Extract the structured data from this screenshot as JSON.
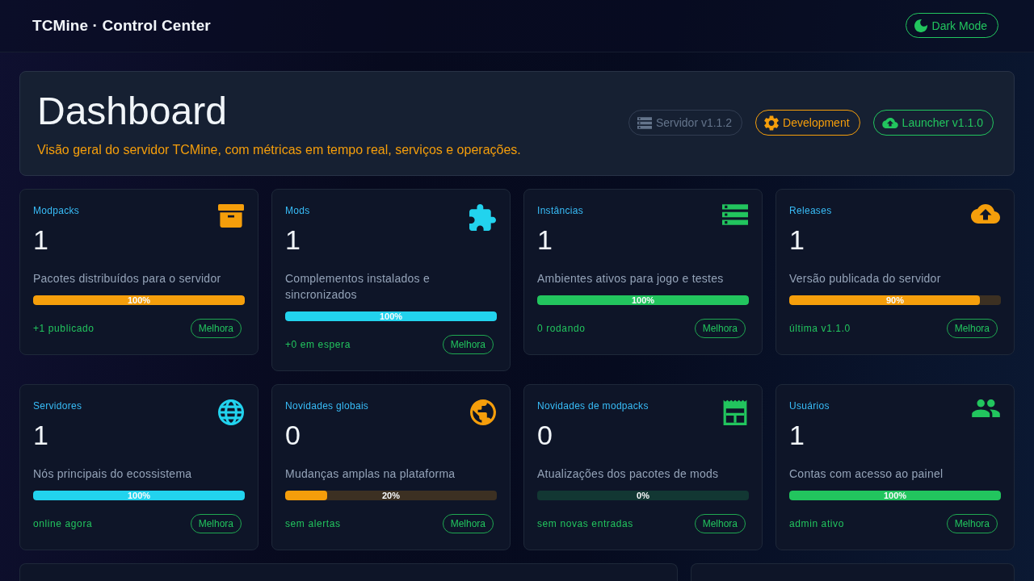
{
  "header": {
    "title": "TCMine · Control Center",
    "theme_toggle": {
      "label": "Dark Mode"
    }
  },
  "hero": {
    "title": "Dashboard",
    "subtitle": "Visão geral do servidor TCMine, com métricas em tempo real, serviços e operações.",
    "badges": [
      {
        "label": "Servidor v1.1.2",
        "disabled": true,
        "color": "#64748b"
      },
      {
        "label": "Development",
        "disabled": false,
        "color": "#f59e0b"
      },
      {
        "label": "Launcher v1.1.0",
        "disabled": false,
        "color": "#22c55e"
      }
    ]
  },
  "cards": [
    {
      "title": "Modpacks",
      "value": "1",
      "description": "Pacotes distribuídos para o servidor",
      "level": 1,
      "reading": "100%",
      "note": "+1 publicado",
      "action": "Melhora",
      "color": "#f59e0b"
    },
    {
      "title": "Mods",
      "value": "1",
      "description": "Complementos instalados e sincronizados",
      "level": 1,
      "reading": "100%",
      "note": "+0 em espera",
      "action": "Melhora",
      "color": "#22d3ee"
    },
    {
      "title": "Instâncias",
      "value": "1",
      "description": "Ambientes ativos para jogo e testes",
      "level": 1,
      "reading": "100%",
      "note": "0 rodando",
      "action": "Melhora",
      "color": "#22c55e"
    },
    {
      "title": "Releases",
      "value": "1",
      "description": "Versão publicada do servidor",
      "level": 0.9,
      "reading": "90%",
      "note": "última v1.1.0",
      "action": "Melhora",
      "color": "#f59e0b"
    },
    {
      "title": "Servidores",
      "value": "1",
      "description": "Nós principais do ecossistema",
      "level": 1,
      "reading": "100%",
      "note": "online agora",
      "action": "Melhora",
      "color": "#22d3ee"
    },
    {
      "title": "Novidades globais",
      "value": "0",
      "description": "Mudanças amplas na plataforma",
      "level": 0.2,
      "reading": "20%",
      "note": "sem alertas",
      "action": "Melhora",
      "color": "#f59e0b"
    },
    {
      "title": "Novidades de modpacks",
      "value": "0",
      "description": "Atualizações dos pacotes de mods",
      "level": 0,
      "reading": "0%",
      "note": "sem novas entradas",
      "action": "Melhora",
      "color": "#22c55e"
    },
    {
      "title": "Usuários",
      "value": "1",
      "description": "Contas com acesso ao painel",
      "level": 1,
      "reading": "100%",
      "note": "admin ativo",
      "action": "Melhora",
      "color": "#22c55e"
    }
  ]
}
